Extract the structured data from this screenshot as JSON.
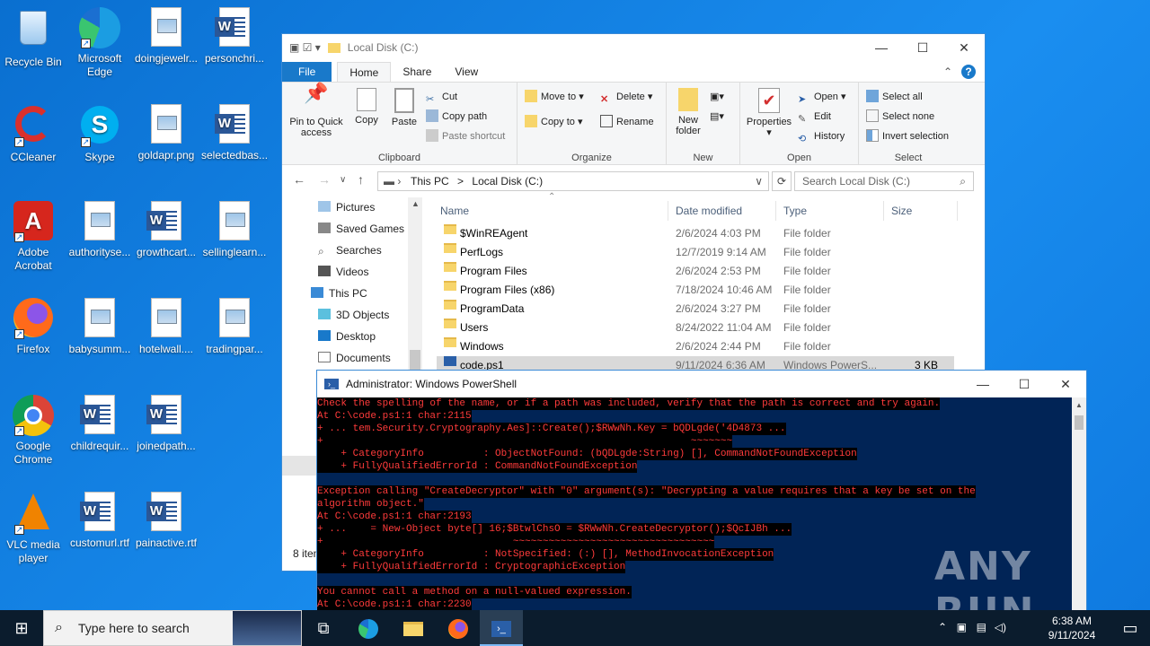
{
  "desktop": {
    "icons": [
      {
        "label": "Recycle Bin"
      },
      {
        "label": "Microsoft Edge"
      },
      {
        "label": "doingjewelr..."
      },
      {
        "label": "personchri..."
      },
      {
        "label": "CCleaner"
      },
      {
        "label": "Skype"
      },
      {
        "label": "goldapr.png"
      },
      {
        "label": "selectedbas..."
      },
      {
        "label": "Adobe Acrobat"
      },
      {
        "label": "authorityse..."
      },
      {
        "label": "growthcart..."
      },
      {
        "label": "sellinglearn..."
      },
      {
        "label": "Firefox"
      },
      {
        "label": "babysumm..."
      },
      {
        "label": "hotelwall...."
      },
      {
        "label": "tradingpar..."
      },
      {
        "label": "Google Chrome"
      },
      {
        "label": "childrequir..."
      },
      {
        "label": "joinedpath..."
      },
      {
        "label": "VLC media player"
      },
      {
        "label": "customurl.rtf"
      },
      {
        "label": "painactive.rtf"
      }
    ]
  },
  "explorer": {
    "title": "Local Disk (C:)",
    "tabs": {
      "file": "File",
      "home": "Home",
      "share": "Share",
      "view": "View"
    },
    "ribbon": {
      "pin": "Pin to Quick access",
      "copy": "Copy",
      "paste": "Paste",
      "cut": "Cut",
      "copy_path": "Copy path",
      "paste_shortcut": "Paste shortcut",
      "clipboard": "Clipboard",
      "move_to": "Move to",
      "copy_to": "Copy to",
      "delete": "Delete",
      "rename": "Rename",
      "organize": "Organize",
      "new_folder": "New folder",
      "new": "New",
      "properties": "Properties",
      "open": "Open",
      "edit": "Edit",
      "history": "History",
      "open_group": "Open",
      "select_all": "Select all",
      "select_none": "Select none",
      "invert_selection": "Invert selection",
      "select": "Select"
    },
    "address": {
      "this_pc": "This PC",
      "sep": ">",
      "local_disk": "Local Disk (C:)"
    },
    "search_placeholder": "Search Local Disk (C:)",
    "nav": [
      "Pictures",
      "Saved Games",
      "Searches",
      "Videos",
      "This PC",
      "3D Objects",
      "Desktop",
      "Documents"
    ],
    "columns": {
      "name": "Name",
      "date": "Date modified",
      "type": "Type",
      "size": "Size"
    },
    "files": [
      {
        "name": "$WinREAgent",
        "date": "2/6/2024 4:03 PM",
        "type": "File folder",
        "size": ""
      },
      {
        "name": "PerfLogs",
        "date": "12/7/2019 9:14 AM",
        "type": "File folder",
        "size": ""
      },
      {
        "name": "Program Files",
        "date": "2/6/2024 2:53 PM",
        "type": "File folder",
        "size": ""
      },
      {
        "name": "Program Files (x86)",
        "date": "7/18/2024 10:46 AM",
        "type": "File folder",
        "size": ""
      },
      {
        "name": "ProgramData",
        "date": "2/6/2024 3:27 PM",
        "type": "File folder",
        "size": ""
      },
      {
        "name": "Users",
        "date": "8/24/2022 11:04 AM",
        "type": "File folder",
        "size": ""
      },
      {
        "name": "Windows",
        "date": "2/6/2024 2:44 PM",
        "type": "File folder",
        "size": ""
      },
      {
        "name": "code.ps1",
        "date": "9/11/2024 6:36 AM",
        "type": "Windows PowerS...",
        "size": "3 KB"
      }
    ],
    "status": "8 item"
  },
  "powershell": {
    "title": "Administrator: Windows PowerShell",
    "lines": [
      "Check the spelling of the name, or if a path was included, verify that the path is correct and try again.",
      "At C:\\code.ps1:1 char:2115",
      "+ ... tem.Security.Cryptography.Aes]::Create();$RWwNh.Key = bQDLgde('4D4873 ...",
      "+                                                              ~~~~~~~",
      "    + CategoryInfo          : ObjectNotFound: (bQDLgde:String) [], CommandNotFoundException",
      "    + FullyQualifiedErrorId : CommandNotFoundException",
      "",
      "Exception calling \"CreateDecryptor\" with \"0\" argument(s): \"Decrypting a value requires that a key be set on the",
      "algorithm object.\"",
      "At C:\\code.ps1:1 char:2193",
      "+ ...    = New-Object byte[] 16;$BtwlChsO = $RWwNh.CreateDecryptor();$QcIJBh ...",
      "+                                ~~~~~~~~~~~~~~~~~~~~~~~~~~~~~~~~~~",
      "    + CategoryInfo          : NotSpecified: (:) [], MethodInvocationException",
      "    + FullyQualifiedErrorId : CryptographicException",
      "",
      "You cannot call a method on a null-valued expression.",
      "At C:\\code.ps1:1 char:2230"
    ]
  },
  "watermark": "ANY RUN",
  "taskbar": {
    "search_placeholder": "Type here to search",
    "time": "6:38 AM",
    "date": "9/11/2024"
  }
}
